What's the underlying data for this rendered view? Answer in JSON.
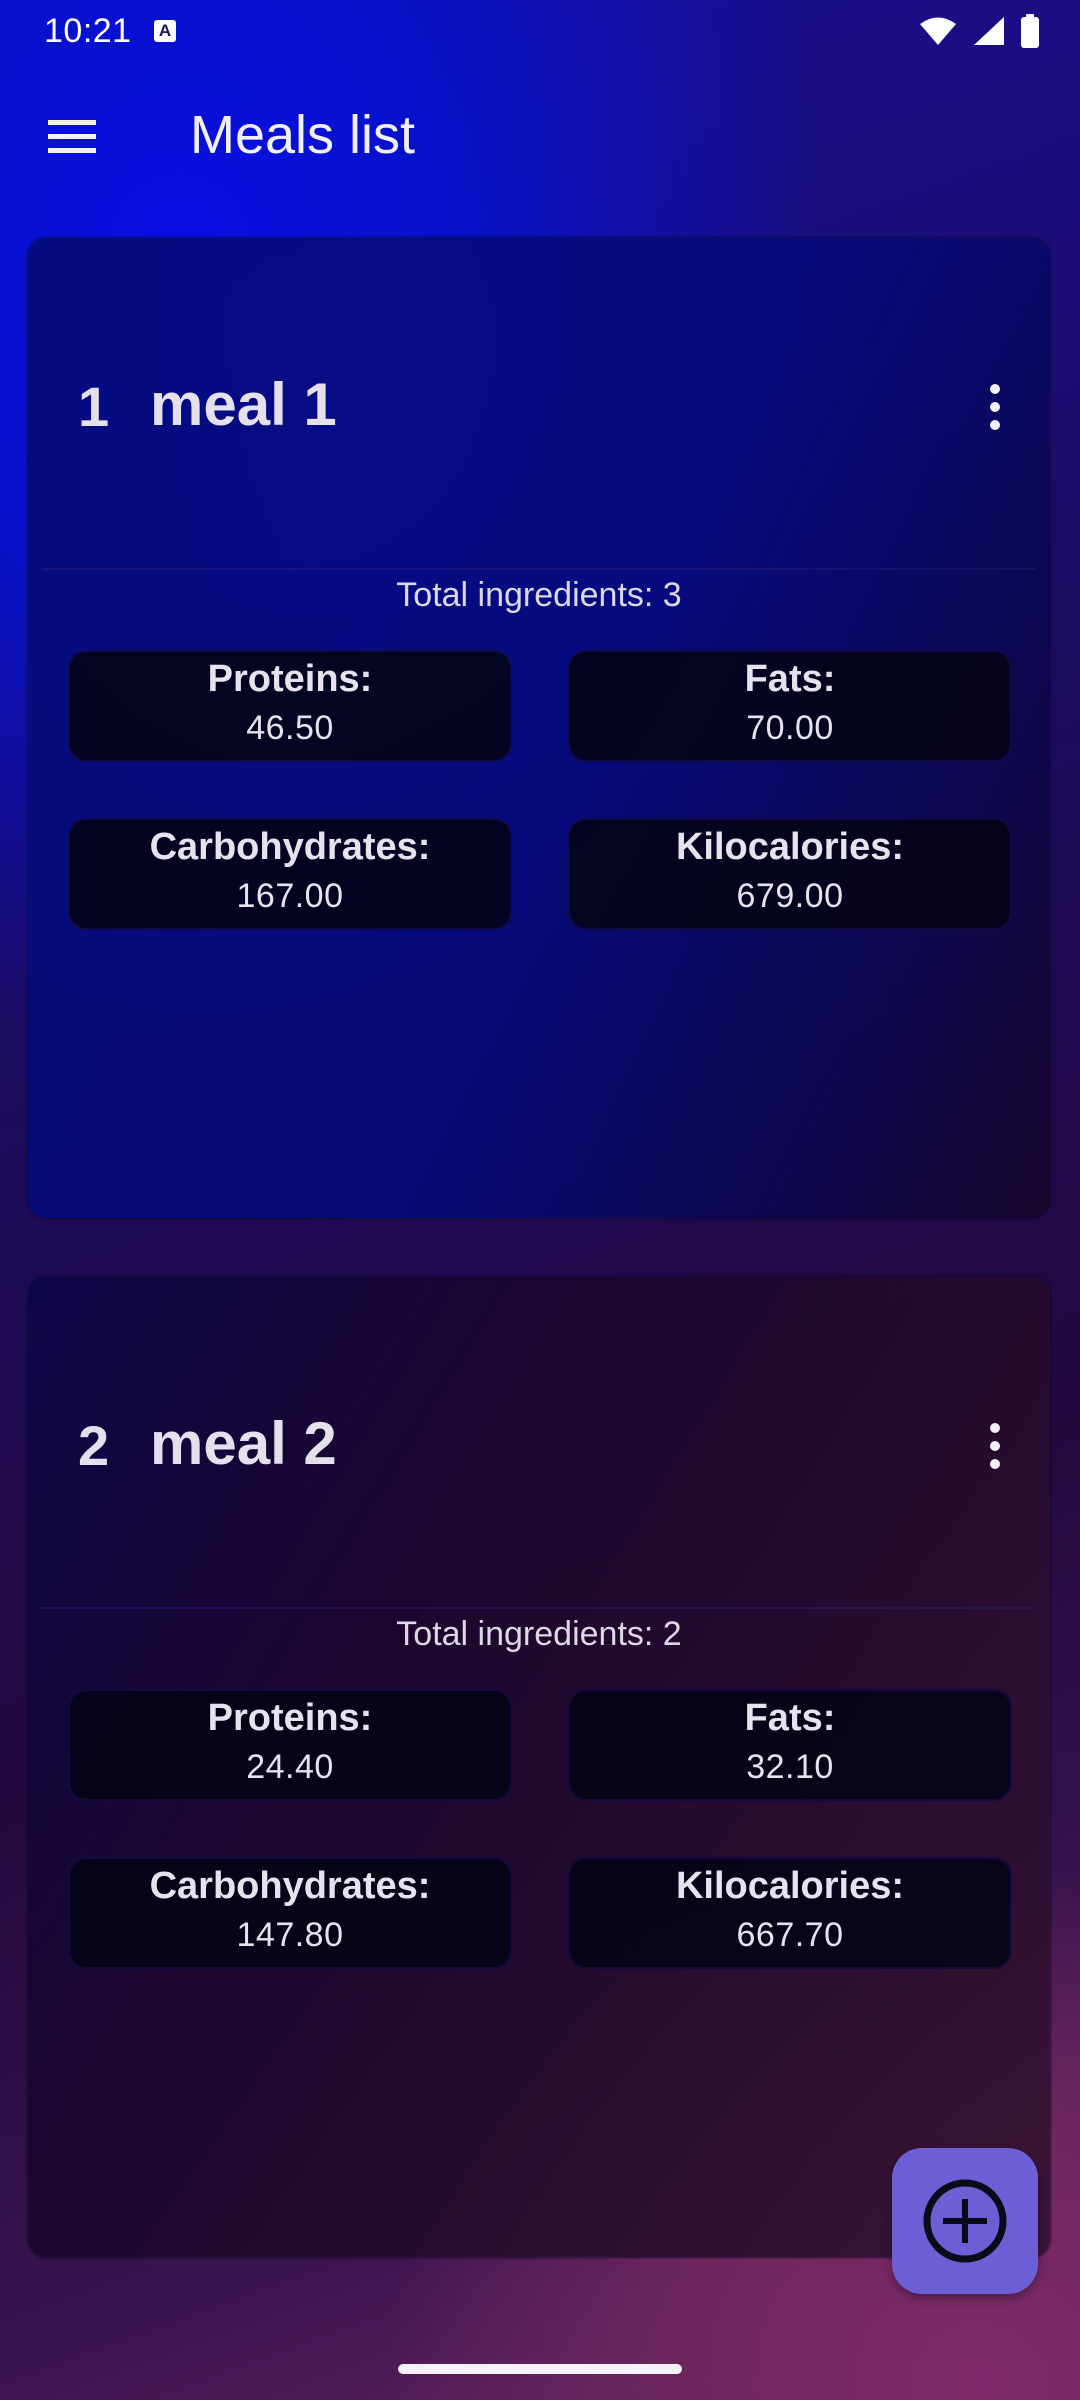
{
  "status_bar": {
    "time": "10:21",
    "notification_icon": "a-badge-icon",
    "icons": [
      "wifi-icon",
      "signal-icon",
      "battery-icon"
    ]
  },
  "app_bar": {
    "menu_icon": "menu-icon",
    "title": "Meals list"
  },
  "meals": [
    {
      "index": "1",
      "name": "meal 1",
      "total_ingredients": "Total ingredients: 3",
      "stats": {
        "proteins_label": "Proteins:",
        "proteins_value": "46.50",
        "fats_label": "Fats:",
        "fats_value": "70.00",
        "carbs_label": "Carbohydrates:",
        "carbs_value": "167.00",
        "kcal_label": "Kilocalories:",
        "kcal_value": "679.00"
      }
    },
    {
      "index": "2",
      "name": "meal 2",
      "total_ingredients": "Total ingredients: 2",
      "stats": {
        "proteins_label": "Proteins:",
        "proteins_value": "24.40",
        "fats_label": "Fats:",
        "fats_value": "32.10",
        "carbs_label": "Carbohydrates:",
        "carbs_value": "147.80",
        "kcal_label": "Kilocalories:",
        "kcal_value": "667.70"
      }
    }
  ],
  "fab": {
    "icon": "add-circle-icon",
    "color": "#6c5fd6"
  },
  "colors": {
    "primary_blue": "#0711c9",
    "accent_purple": "#6c5fd6",
    "magenta": "#7f2a6a"
  }
}
